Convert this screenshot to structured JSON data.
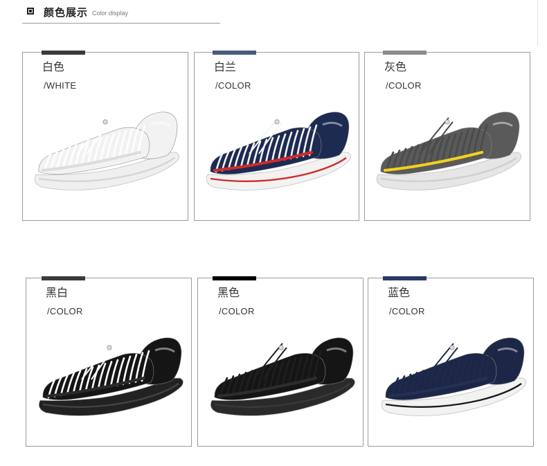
{
  "header": {
    "title": "颜色展示",
    "subtitle": "Color display"
  },
  "cards": [
    {
      "name": "白色",
      "label_en": "/WHITE",
      "tab_color": "#3a3a3a",
      "upper_color": "#f2f2f2",
      "weave_color": "#ffffff",
      "accent_color": "#dcdcdc",
      "sole_color": "#efefef",
      "stripe_color": "#d5d5d5",
      "icon": "white-sandal"
    },
    {
      "name": "白兰",
      "label_en": "/COLOR",
      "tab_color": "#4a5a7c",
      "upper_color": "#1d2a52",
      "weave_color": "#f4f4f4",
      "accent_color": "#d12a2a",
      "sole_color": "#f2f2f2",
      "stripe_color": "#d12a2a",
      "icon": "navy-red-sandal"
    },
    {
      "name": "灰色",
      "label_en": "/COLOR",
      "tab_color": "#8c8c8c",
      "upper_color": "#5a5a5a",
      "weave_color": "#4a4a4a",
      "accent_color": "#f2d11e",
      "sole_color": "#e6e6e6",
      "stripe_color": "#cfcfcf",
      "icon": "grey-yellow-sandal"
    },
    {
      "name": "黑白",
      "label_en": "/COLOR",
      "tab_color": "#3a3a3a",
      "upper_color": "#151515",
      "weave_color": "#ffffff",
      "accent_color": "#2a2a2a",
      "sole_color": "#222222",
      "stripe_color": "#444444",
      "icon": "black-white-sandal"
    },
    {
      "name": "黑色",
      "label_en": "/COLOR",
      "tab_color": "#000000",
      "upper_color": "#151515",
      "weave_color": "#1f1f1f",
      "accent_color": "#2d2d2d",
      "sole_color": "#2a2a2a",
      "stripe_color": "#3a3a3a",
      "icon": "black-sandal"
    },
    {
      "name": "蓝色",
      "label_en": "/COLOR",
      "tab_color": "#2a3a64",
      "upper_color": "#1c2748",
      "weave_color": "#1f2a4a",
      "accent_color": "#233156",
      "sole_color": "#f2f2f2",
      "stripe_color": "#1a1a1a",
      "icon": "navy-sandal"
    }
  ]
}
